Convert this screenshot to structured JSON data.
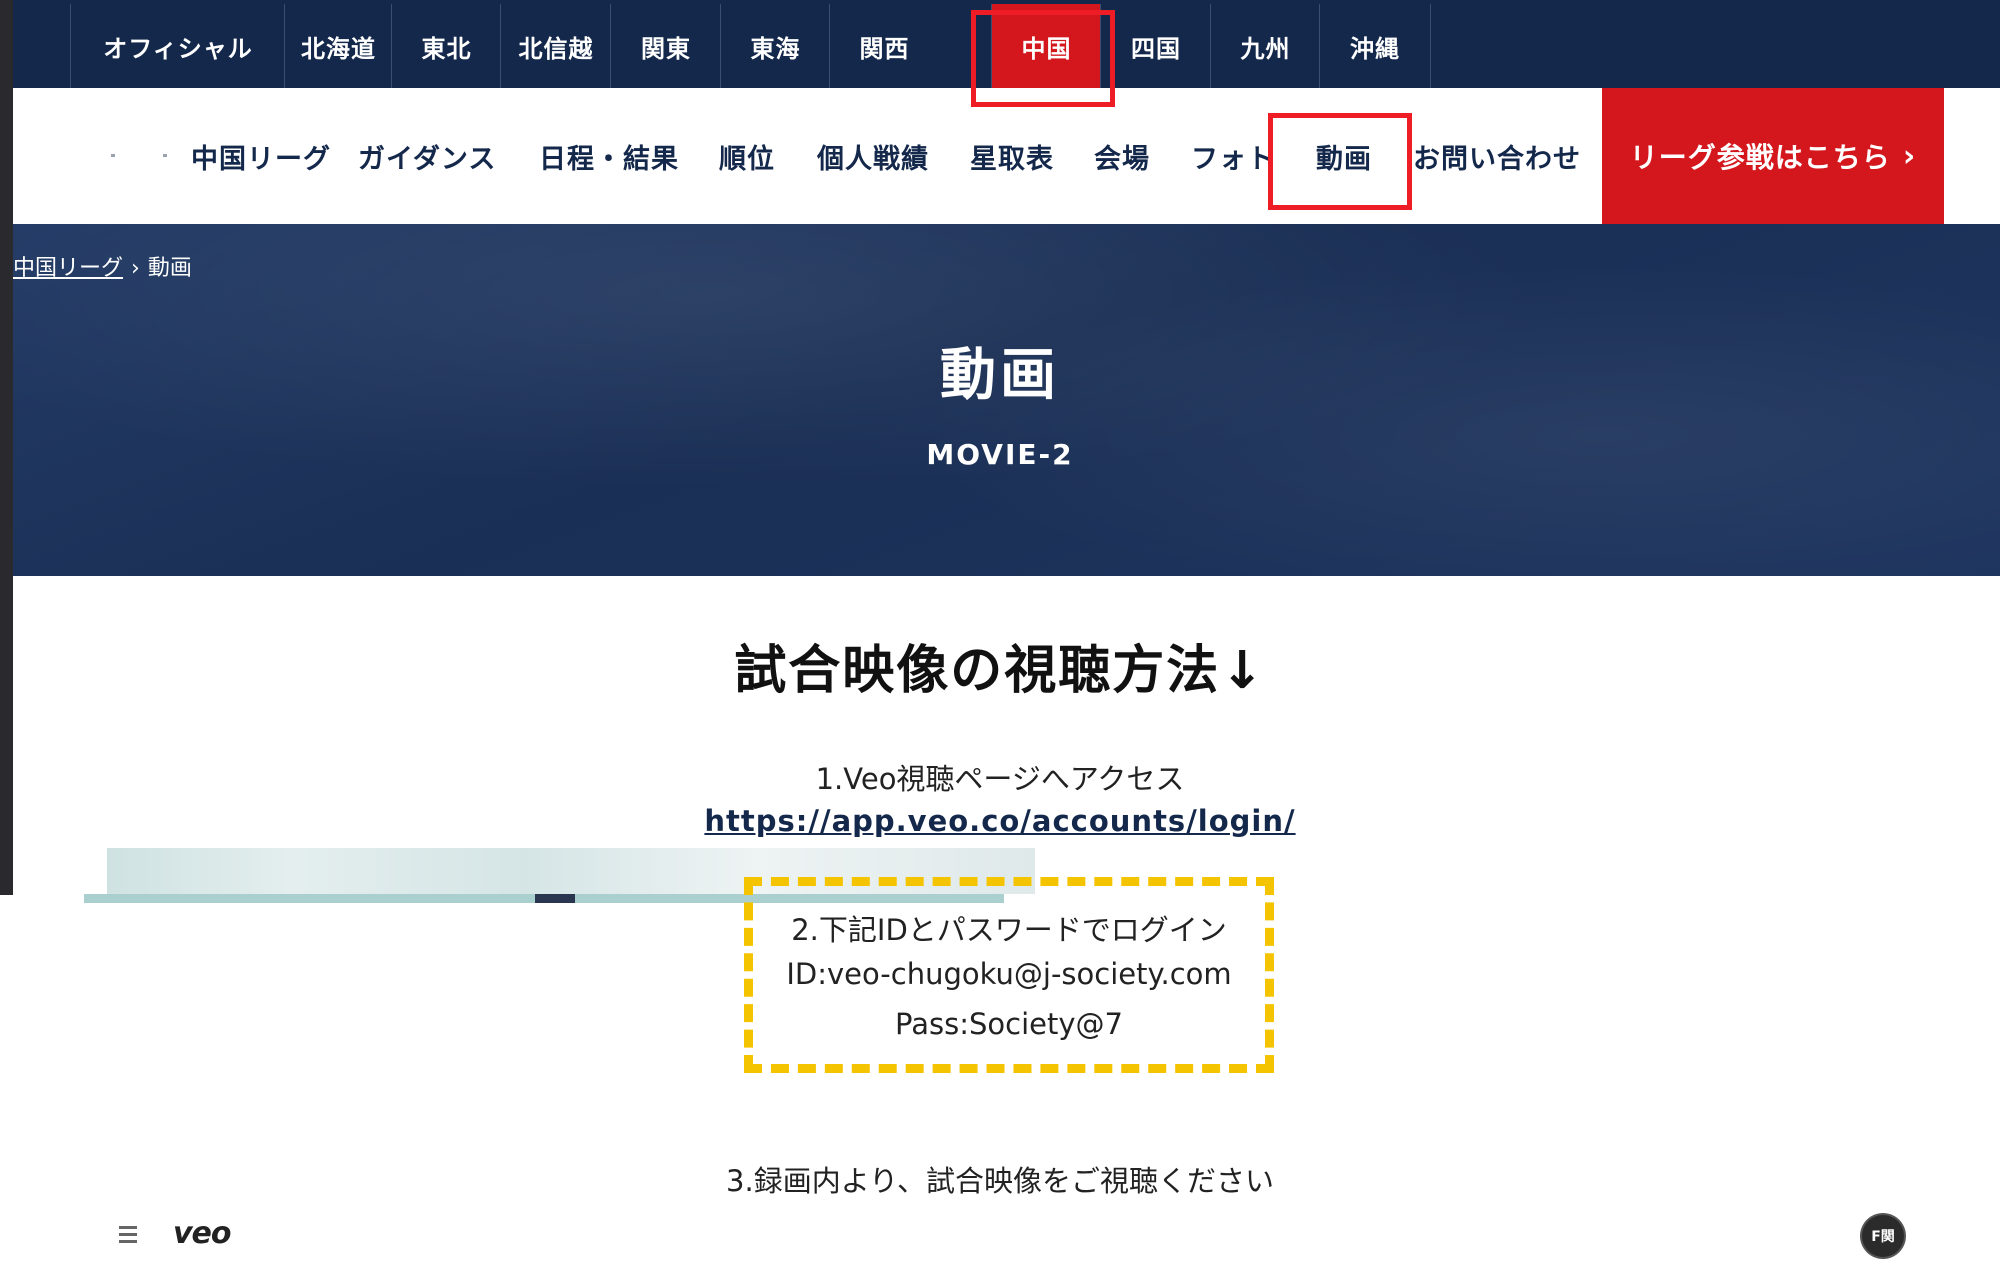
{
  "top_nav": {
    "items": [
      "オフィシャル",
      "北海道",
      "東北",
      "北信越",
      "関東",
      "東海",
      "関西",
      "中国",
      "四国",
      "九州",
      "沖縄"
    ],
    "active": "中国"
  },
  "sub_nav": {
    "items": [
      "中国リーグ",
      "ガイダンス",
      "日程・結果",
      "順位",
      "個人戦績",
      "星取表",
      "会場",
      "フォト",
      "動画",
      "お問い合わせ"
    ],
    "highlighted": "動画",
    "cta_label": "リーグ参戦はこちら",
    "cta_chevron": "›"
  },
  "breadcrumb": {
    "home": "中国リーグ",
    "separator": "›",
    "current": "動画"
  },
  "hero": {
    "title": "動画",
    "subtitle": "MOVIE-2"
  },
  "content": {
    "section_title": "試合映像の視聴方法↓",
    "step1": "1.Veo視聴ページへアクセス",
    "login_url": "https://app.veo.co/accounts/login/",
    "step2": "2.下記IDとパスワードでログイン",
    "id_line": "ID:veo-chugoku@j-society.com",
    "pass_line": "Pass:Society@7",
    "step3": "3.録画内より、試合映像をご視聴ください"
  },
  "veo_bar": {
    "logo": "veo",
    "avatar": "F関"
  },
  "colors": {
    "navy": "#14284b",
    "red": "#d4161d",
    "highlight": "#ee1c24",
    "dashed": "#f5c400"
  }
}
